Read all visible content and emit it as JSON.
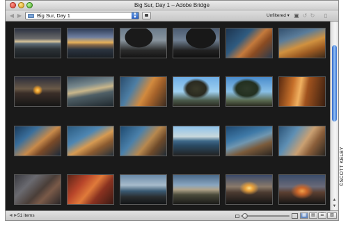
{
  "window": {
    "title": "Big Sur, Day 1 – Adobe Bridge"
  },
  "toolbar": {
    "back_icon": "back-arrow-icon",
    "forward_icon": "forward-arrow-icon",
    "path_value": "Big Sur, Day 1",
    "filter_label": "Unfiltered"
  },
  "content": {
    "thumbnails": [
      {
        "row": 1,
        "col": 1,
        "scene": "sunset over sea, dark rocks"
      },
      {
        "row": 1,
        "col": 2,
        "scene": "golden sunset over water"
      },
      {
        "row": 1,
        "col": 3,
        "scene": "cypress tree silhouette"
      },
      {
        "row": 1,
        "col": 4,
        "scene": "cypress trees at dusk"
      },
      {
        "row": 1,
        "col": 5,
        "scene": "orange rocks, blue sea"
      },
      {
        "row": 1,
        "col": 6,
        "scene": "golden cliffs and ocean"
      },
      {
        "row": 2,
        "col": 1,
        "scene": "sun setting behind rocks"
      },
      {
        "row": 2,
        "col": 2,
        "scene": "waves on shore"
      },
      {
        "row": 2,
        "col": 3,
        "scene": "rocky coast, golden light"
      },
      {
        "row": 2,
        "col": 4,
        "scene": "cypress tree against sky"
      },
      {
        "row": 2,
        "col": 5,
        "scene": "cypress tree on cliff"
      },
      {
        "row": 2,
        "col": 6,
        "scene": "warm lit tree trunks"
      },
      {
        "row": 3,
        "col": 1,
        "scene": "rocks and blue water"
      },
      {
        "row": 3,
        "col": 2,
        "scene": "sunlit rocks in surf"
      },
      {
        "row": 3,
        "col": 3,
        "scene": "surf and rock outcrop"
      },
      {
        "row": 3,
        "col": 4,
        "scene": "distant horizon and rocks"
      },
      {
        "row": 3,
        "col": 5,
        "scene": "waves over rocks"
      },
      {
        "row": 3,
        "col": 6,
        "scene": "large rock formation"
      },
      {
        "row": 4,
        "col": 1,
        "scene": "textured rock close-up"
      },
      {
        "row": 4,
        "col": 2,
        "scene": "red lichen on rock"
      },
      {
        "row": 4,
        "col": 3,
        "scene": "coastline at dusk"
      },
      {
        "row": 4,
        "col": 4,
        "scene": "houses on coastal cliff"
      },
      {
        "row": 4,
        "col": 5,
        "scene": "sun on horizon"
      },
      {
        "row": 4,
        "col": 6,
        "scene": "sunset glow over sea"
      }
    ]
  },
  "status": {
    "items_count": "51 items"
  },
  "watermark": "©SCOTT KELBY"
}
